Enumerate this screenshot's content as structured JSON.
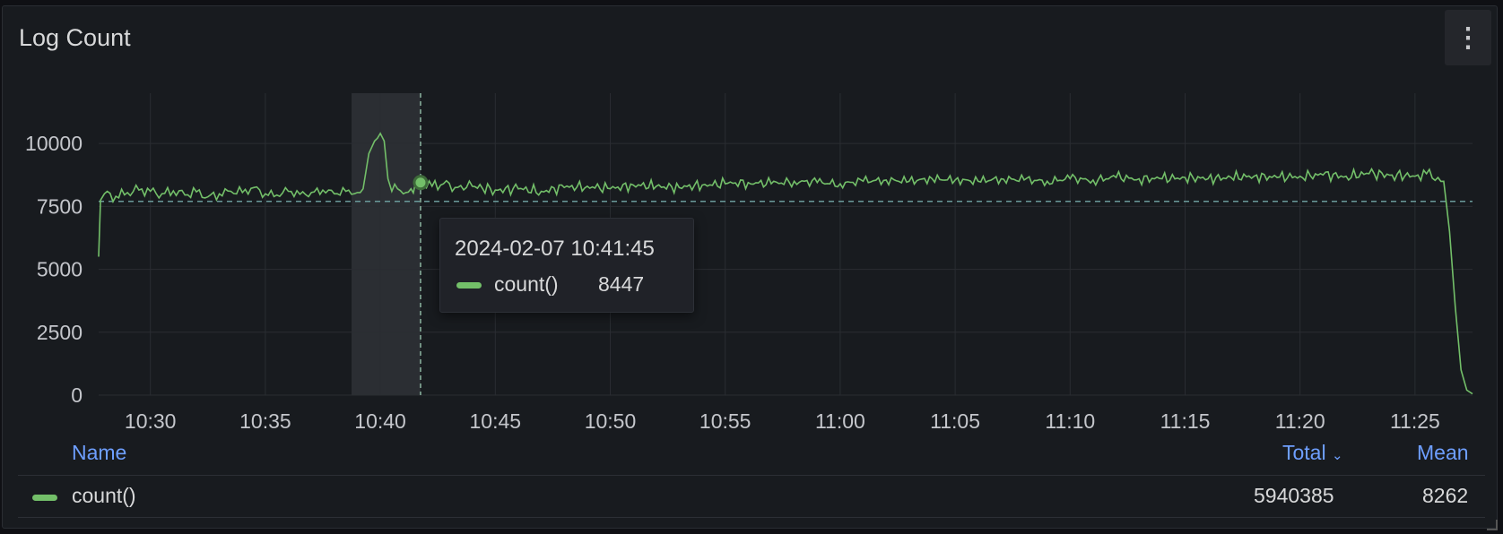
{
  "panel": {
    "title": "Log Count",
    "menu_icon": "vertical-ellipsis-icon"
  },
  "tooltip": {
    "time": "2024-02-07 10:41:45",
    "series_name": "count()",
    "value": "8447"
  },
  "legend": {
    "headers": {
      "name": "Name",
      "total": "Total",
      "total_sort_icon": "chevron-down-icon",
      "mean": "Mean"
    },
    "rows": [
      {
        "name": "count()",
        "total": "5940385",
        "mean": "8262",
        "color": "#73bf69"
      }
    ]
  },
  "chart_data": {
    "type": "line",
    "title": "Log Count",
    "xlabel": "",
    "ylabel": "",
    "ylim": [
      0,
      12000
    ],
    "xlim": [
      "10:27:45",
      "11:27:30"
    ],
    "y_ticks": [
      0,
      2500,
      5000,
      7500,
      10000
    ],
    "x_ticks": [
      "10:30",
      "10:35",
      "10:40",
      "10:45",
      "10:50",
      "10:55",
      "11:00",
      "11:05",
      "11:10",
      "11:15",
      "11:20",
      "11:25"
    ],
    "grid": true,
    "mean_line": 7700,
    "hover": {
      "x": "10:41:45",
      "y": 8447
    },
    "highlight_region": [
      "10:38:45",
      "10:41:45"
    ],
    "series": [
      {
        "name": "count()",
        "color": "#73bf69",
        "points": [
          [
            "10:27:45",
            5500
          ],
          [
            "10:27:50",
            7750
          ],
          [
            "10:28:00",
            8000
          ],
          [
            "10:28:30",
            7900
          ],
          [
            "10:29:00",
            8050
          ],
          [
            "10:29:30",
            8150
          ],
          [
            "10:30:00",
            8100
          ],
          [
            "10:30:30",
            8000
          ],
          [
            "10:31:00",
            8120
          ],
          [
            "10:31:30",
            7950
          ],
          [
            "10:32:00",
            8080
          ],
          [
            "10:32:30",
            7880
          ],
          [
            "10:33:00",
            8000
          ],
          [
            "10:33:30",
            8100
          ],
          [
            "10:34:00",
            8050
          ],
          [
            "10:34:30",
            8250
          ],
          [
            "10:35:00",
            8000
          ],
          [
            "10:35:30",
            7950
          ],
          [
            "10:36:00",
            8100
          ],
          [
            "10:36:30",
            7980
          ],
          [
            "10:37:00",
            8050
          ],
          [
            "10:37:30",
            8150
          ],
          [
            "10:38:00",
            8000
          ],
          [
            "10:38:30",
            8100
          ],
          [
            "10:39:00",
            8050
          ],
          [
            "10:39:15",
            8200
          ],
          [
            "10:39:30",
            9600
          ],
          [
            "10:39:45",
            10100
          ],
          [
            "10:40:00",
            10400
          ],
          [
            "10:40:10",
            10100
          ],
          [
            "10:40:20",
            8600
          ],
          [
            "10:40:30",
            8100
          ],
          [
            "10:40:45",
            8200
          ],
          [
            "10:41:00",
            8000
          ],
          [
            "10:41:20",
            8200
          ],
          [
            "10:41:45",
            8447
          ],
          [
            "10:42:15",
            8300
          ],
          [
            "10:42:45",
            8400
          ],
          [
            "10:43:15",
            8250
          ],
          [
            "10:44:00",
            8300
          ],
          [
            "10:45:00",
            8150
          ],
          [
            "10:46:00",
            8200
          ],
          [
            "10:47:00",
            8100
          ],
          [
            "10:48:00",
            8250
          ],
          [
            "10:49:00",
            8300
          ],
          [
            "10:50:00",
            8200
          ],
          [
            "10:51:00",
            8350
          ],
          [
            "10:52:00",
            8300
          ],
          [
            "10:53:00",
            8250
          ],
          [
            "10:54:00",
            8350
          ],
          [
            "10:55:00",
            8400
          ],
          [
            "10:56:00",
            8450
          ],
          [
            "10:57:00",
            8400
          ],
          [
            "10:58:00",
            8500
          ],
          [
            "10:59:00",
            8450
          ],
          [
            "11:00:00",
            8400
          ],
          [
            "11:01:00",
            8500
          ],
          [
            "11:02:00",
            8550
          ],
          [
            "11:03:00",
            8500
          ],
          [
            "11:04:00",
            8600
          ],
          [
            "11:05:00",
            8550
          ],
          [
            "11:06:00",
            8500
          ],
          [
            "11:07:00",
            8600
          ],
          [
            "11:08:00",
            8550
          ],
          [
            "11:09:00",
            8500
          ],
          [
            "11:10:00",
            8600
          ],
          [
            "11:11:00",
            8550
          ],
          [
            "11:12:00",
            8650
          ],
          [
            "11:13:00",
            8600
          ],
          [
            "11:14:00",
            8600
          ],
          [
            "11:15:00",
            8650
          ],
          [
            "11:16:00",
            8600
          ],
          [
            "11:17:00",
            8650
          ],
          [
            "11:18:00",
            8700
          ],
          [
            "11:19:00",
            8650
          ],
          [
            "11:20:00",
            8700
          ],
          [
            "11:21:00",
            8750
          ],
          [
            "11:22:00",
            8700
          ],
          [
            "11:23:00",
            8800
          ],
          [
            "11:24:00",
            8750
          ],
          [
            "11:25:00",
            8700
          ],
          [
            "11:25:30",
            8800
          ],
          [
            "11:26:00",
            8650
          ],
          [
            "11:26:15",
            8500
          ],
          [
            "11:26:30",
            6500
          ],
          [
            "11:26:45",
            3500
          ],
          [
            "11:27:00",
            1000
          ],
          [
            "11:27:15",
            200
          ],
          [
            "11:27:30",
            50
          ]
        ]
      }
    ]
  }
}
